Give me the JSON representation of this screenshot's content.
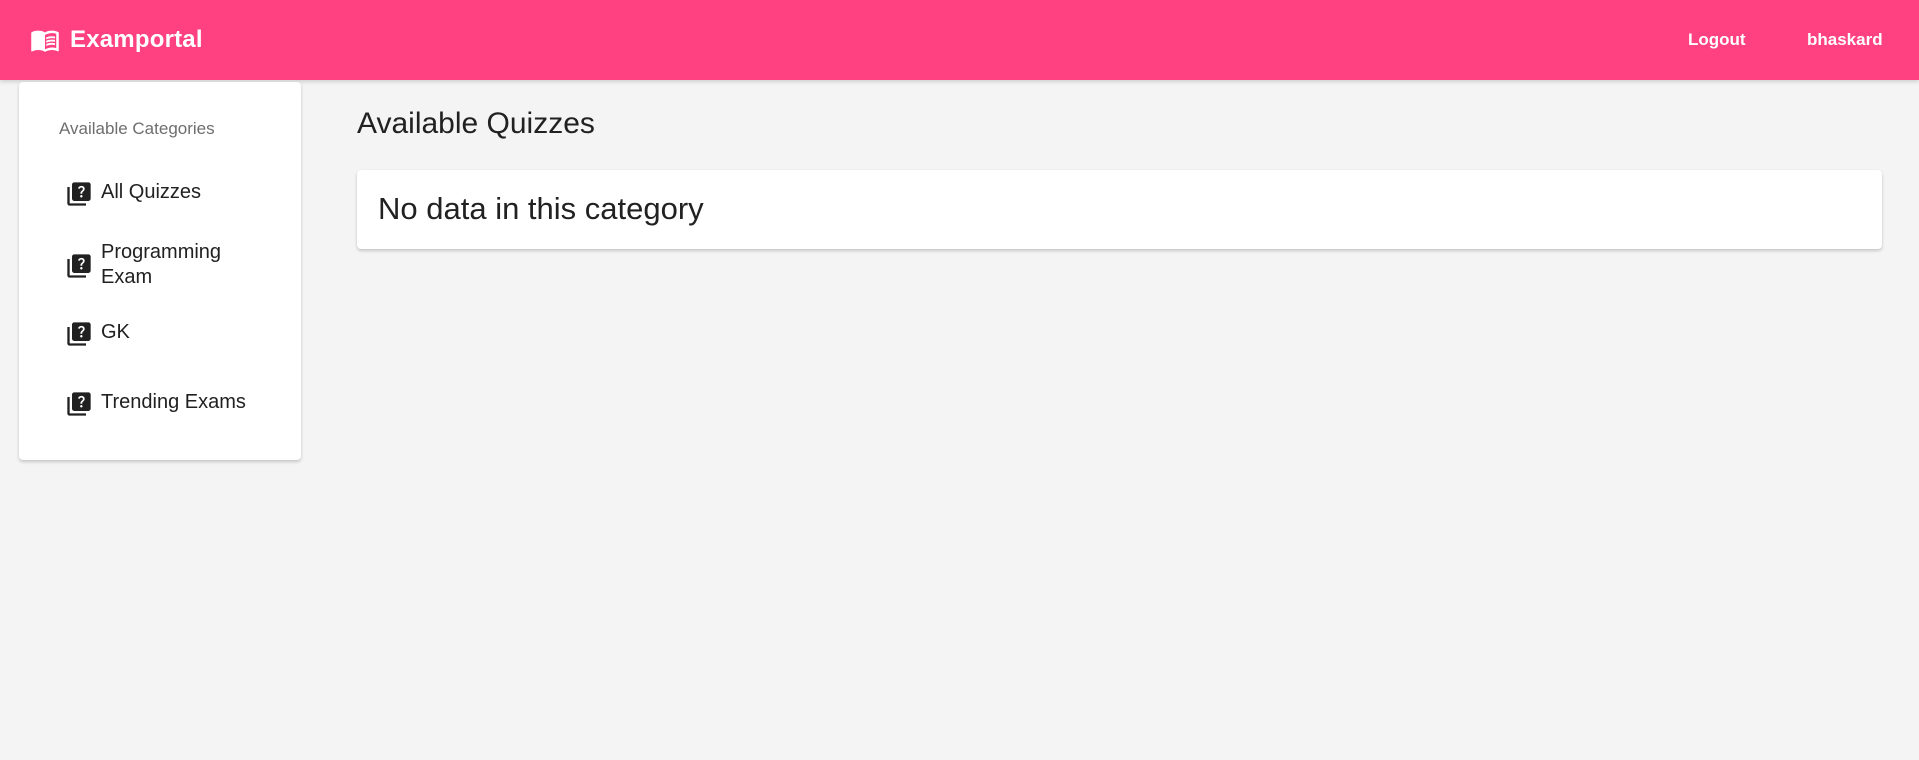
{
  "app": {
    "name": "Examportal",
    "brand_icon": "open-book-icon",
    "accent_color": "#ff4081"
  },
  "navbar": {
    "logout_label": "Logout",
    "username": "bhaskard"
  },
  "sidebar": {
    "title": "Available Categories",
    "items": [
      {
        "label": "All Quizzes",
        "icon": "quiz-icon"
      },
      {
        "label": "Programming Exam",
        "icon": "quiz-icon"
      },
      {
        "label": "GK",
        "icon": "quiz-icon"
      },
      {
        "label": "Trending Exams",
        "icon": "quiz-icon"
      }
    ]
  },
  "main": {
    "title": "Available Quizzes",
    "empty_message": "No data in this category"
  }
}
